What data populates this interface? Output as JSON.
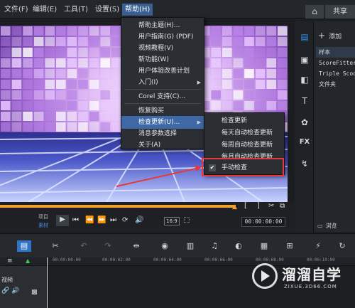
{
  "menubar": {
    "items": [
      "文件(F)",
      "编辑(E)",
      "工具(T)",
      "设置(S)",
      "帮助(H)"
    ],
    "share_tab": "共享"
  },
  "help_menu": {
    "items": [
      "帮助主题(H)...",
      "用户指南(G) (PDF)",
      "视频教程(V)",
      "新功能(W)",
      "用户体验改善计划",
      "入门(I)",
      "Corel 支持(C)...",
      "恢复购买",
      "检查更新(U)...",
      "消息参数选择",
      "关于(A)"
    ]
  },
  "update_submenu": {
    "items": [
      "检查更新",
      "每天自动检查更新",
      "每周自动检查更新",
      "每月自动检查更新",
      "手动检查"
    ],
    "checked_index": 4
  },
  "right_panel": {
    "add_label": "添加",
    "library": [
      "样本",
      "ScoreFitter",
      "Triple Scoop",
      "文件夹"
    ],
    "browse_label": "浏览"
  },
  "transport": {
    "project_label": "项目",
    "clip_label": "素材",
    "aspect": "16:9",
    "timecode": "00:00:00:00"
  },
  "ruler": {
    "labels": [
      "00:00:00:00",
      "00:00:02:00",
      "00:00:04:00",
      "00:00:06:00",
      "00:00:08:00",
      "00:00:10:00"
    ]
  },
  "track": {
    "name": "视频"
  },
  "watermark": {
    "title": "溜溜自学",
    "subtitle": "ZIXUE.3D66.COM"
  },
  "colors": {
    "accent": "#3e69a6",
    "highlight": "#e5393a",
    "scrub": "#f0a030"
  }
}
